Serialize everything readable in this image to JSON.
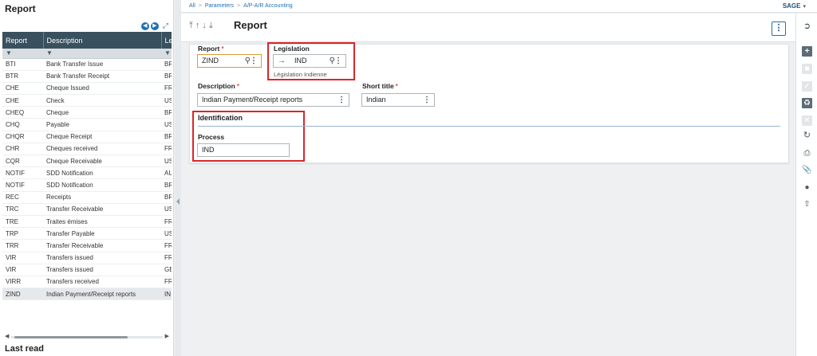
{
  "left_panel": {
    "title": "Report",
    "columns": [
      "Report",
      "Description",
      "Le"
    ],
    "filter_glyph": "▼",
    "rows": [
      {
        "code": "BTI",
        "desc": "Bank Transfer Issue",
        "leg": "BR"
      },
      {
        "code": "BTR",
        "desc": "Bank Transfer Receipt",
        "leg": "BR"
      },
      {
        "code": "CHE",
        "desc": "Cheque Issued",
        "leg": "FR"
      },
      {
        "code": "CHE",
        "desc": "Check",
        "leg": "US"
      },
      {
        "code": "CHEQ",
        "desc": "Cheque",
        "leg": "BR"
      },
      {
        "code": "CHQ",
        "desc": "Payable",
        "leg": "US"
      },
      {
        "code": "CHQR",
        "desc": "Cheque Receipt",
        "leg": "BR"
      },
      {
        "code": "CHR",
        "desc": "Cheques received",
        "leg": "FR"
      },
      {
        "code": "CQR",
        "desc": "Cheque Receivable",
        "leg": "US"
      },
      {
        "code": "NOTIF",
        "desc": "SDD Notification",
        "leg": "AU"
      },
      {
        "code": "NOTIF",
        "desc": "SDD Notification",
        "leg": "BR"
      },
      {
        "code": "REC",
        "desc": "Receipts",
        "leg": "BR"
      },
      {
        "code": "TRC",
        "desc": "Transfer Receivable",
        "leg": "US"
      },
      {
        "code": "TRE",
        "desc": "Traites émises",
        "leg": "FR"
      },
      {
        "code": "TRP",
        "desc": "Transfer Payable",
        "leg": "US"
      },
      {
        "code": "TRR",
        "desc": "Transfer Receivable",
        "leg": "FR"
      },
      {
        "code": "VIR",
        "desc": "Transfers issued",
        "leg": "FR"
      },
      {
        "code": "VIR",
        "desc": "Transfers issued",
        "leg": "GB"
      },
      {
        "code": "VIRR",
        "desc": "Transfers received",
        "leg": "FR"
      },
      {
        "code": "ZIND",
        "desc": "Indian Payment/Receipt reports",
        "leg": "IN"
      }
    ],
    "selected_index": 19,
    "footer_title": "Last read"
  },
  "breadcrumb": [
    "All",
    "Parameters",
    "A/P-A/R Accounting"
  ],
  "brand": "SAGE",
  "header": {
    "title": "Report"
  },
  "form": {
    "report": {
      "label": "Report",
      "value": "ZIND"
    },
    "legislation": {
      "label": "Legislation",
      "value": "IND",
      "description": "Législation Indienne"
    },
    "description": {
      "label": "Description",
      "value": "Indian Payment/Receipt reports"
    },
    "short_title": {
      "label": "Short title",
      "value": "Indian"
    },
    "section_title": "Identification",
    "process": {
      "label": "Process",
      "value": "IND"
    }
  },
  "colors": {
    "accent": "#1f6fb2",
    "header_bg": "#39505f",
    "highlight": "#d9262c",
    "required": "#e45b3f"
  }
}
